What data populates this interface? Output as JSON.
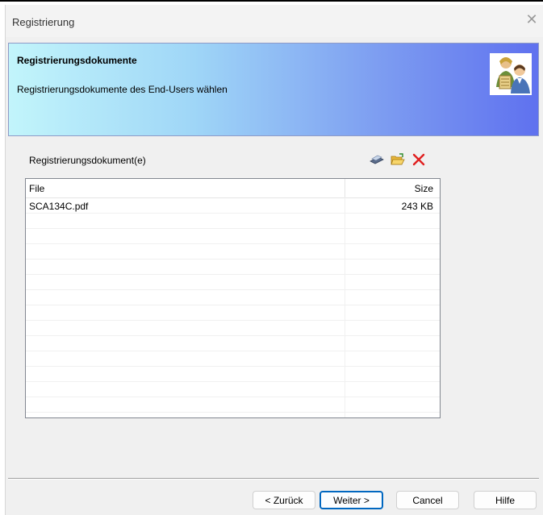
{
  "window": {
    "title": "Registrierung"
  },
  "header": {
    "title": "Registrierungsdokumente",
    "subtitle": "Registrierungsdokumente des End-Users wählen"
  },
  "documents": {
    "label": "Registrierungsdokument(e)",
    "columns": {
      "file": "File",
      "size": "Size"
    },
    "rows": [
      {
        "file": "SCA134C.pdf",
        "size": "243 KB"
      },
      {
        "file": "",
        "size": ""
      },
      {
        "file": "",
        "size": ""
      },
      {
        "file": "",
        "size": ""
      },
      {
        "file": "",
        "size": ""
      },
      {
        "file": "",
        "size": ""
      },
      {
        "file": "",
        "size": ""
      },
      {
        "file": "",
        "size": ""
      },
      {
        "file": "",
        "size": ""
      },
      {
        "file": "",
        "size": ""
      },
      {
        "file": "",
        "size": ""
      },
      {
        "file": "",
        "size": ""
      },
      {
        "file": "",
        "size": ""
      },
      {
        "file": "",
        "size": ""
      }
    ]
  },
  "toolbar": {
    "icons": [
      "scan-icon",
      "open-folder-icon",
      "delete-icon"
    ],
    "delete_color": "#e02020"
  },
  "buttons": {
    "back": "< Zurück",
    "next": "Weiter >",
    "cancel": "Cancel",
    "help": "Hilfe"
  }
}
